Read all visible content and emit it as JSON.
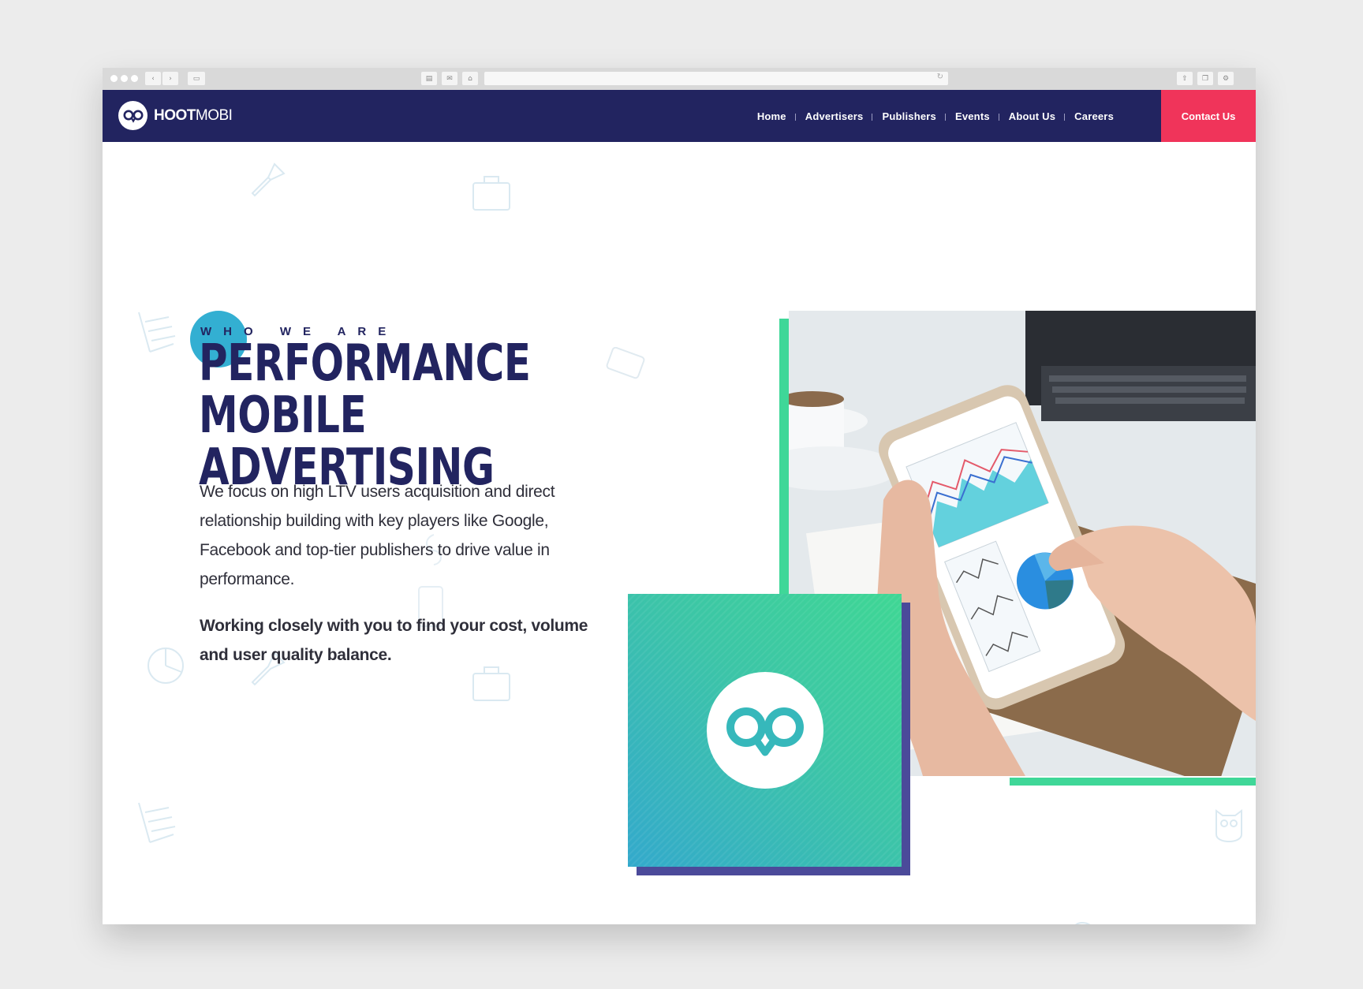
{
  "browser": {
    "nav_back_icon": "chevron-left-icon",
    "nav_forward_icon": "chevron-right-icon"
  },
  "site": {
    "brand_bold": "HOOT",
    "brand_light": "MOBI",
    "nav_items": [
      "Home",
      "Advertisers",
      "Publishers",
      "Events",
      "About Us",
      "Careers"
    ],
    "contact_label": "Contact Us"
  },
  "hero": {
    "eyebrow": "WHO WE ARE",
    "headline_line1": "PERFORMANCE MOBILE",
    "headline_line2": "ADVERTISING",
    "body": "We focus on high LTV users acquisition and direct relationship building with key players like Google, Facebook and top-tier publishers to drive value in performance.",
    "emphasis": "Working closely with you to find your cost, volume and user quality balance."
  },
  "colors": {
    "navy": "#222460",
    "accent_red": "#f0345a",
    "teal": "#33afd2",
    "green": "#3fd798",
    "purple": "#4b4a9a"
  }
}
